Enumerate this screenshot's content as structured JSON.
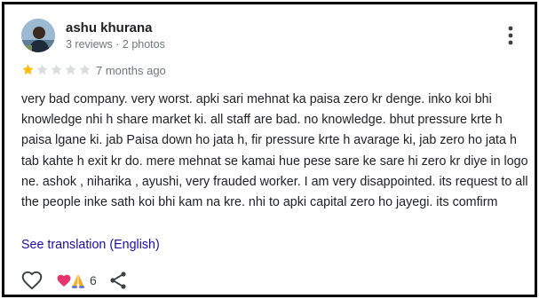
{
  "reviewer": {
    "name": "ashu khurana",
    "meta": "3 reviews · 2 photos"
  },
  "rating": {
    "stars": 1,
    "max": 5,
    "filled_color": "#fbbc04",
    "empty_color": "#dadce0"
  },
  "time_ago": "7 months ago",
  "review": {
    "text": "very bad company. very worst. apki sari mehnat ka paisa zero kr denge. inko koi bhi knowledge nhi h share market ki. all staff are bad. no knowledge. bhut pressure krte h paisa lgane ki. jab Paisa down ho jata h, fir pressure krte h avarage ki, jab zero ho jata h tab kahte h exit kr do. mere mehnat se kamai hue pese sare ke sare hi zero kr diye in logo ne. ashok , niharika , ayushi, very frauded worker. I am very disappointed. its request to all the people inke sath koi bhi kam na kre. nhi to apki capital zero ho jayegi. its comfirm"
  },
  "translate_link": "See translation (English)",
  "reactions": {
    "count": "6",
    "icons": [
      "heart-emoji",
      "folded-hands-emoji"
    ]
  },
  "icons": {
    "more": "more-vert-icon",
    "like": "heart-outline-icon",
    "share": "share-icon"
  },
  "colors": {
    "link": "#1a0dab",
    "secondary_text": "#70757a"
  }
}
